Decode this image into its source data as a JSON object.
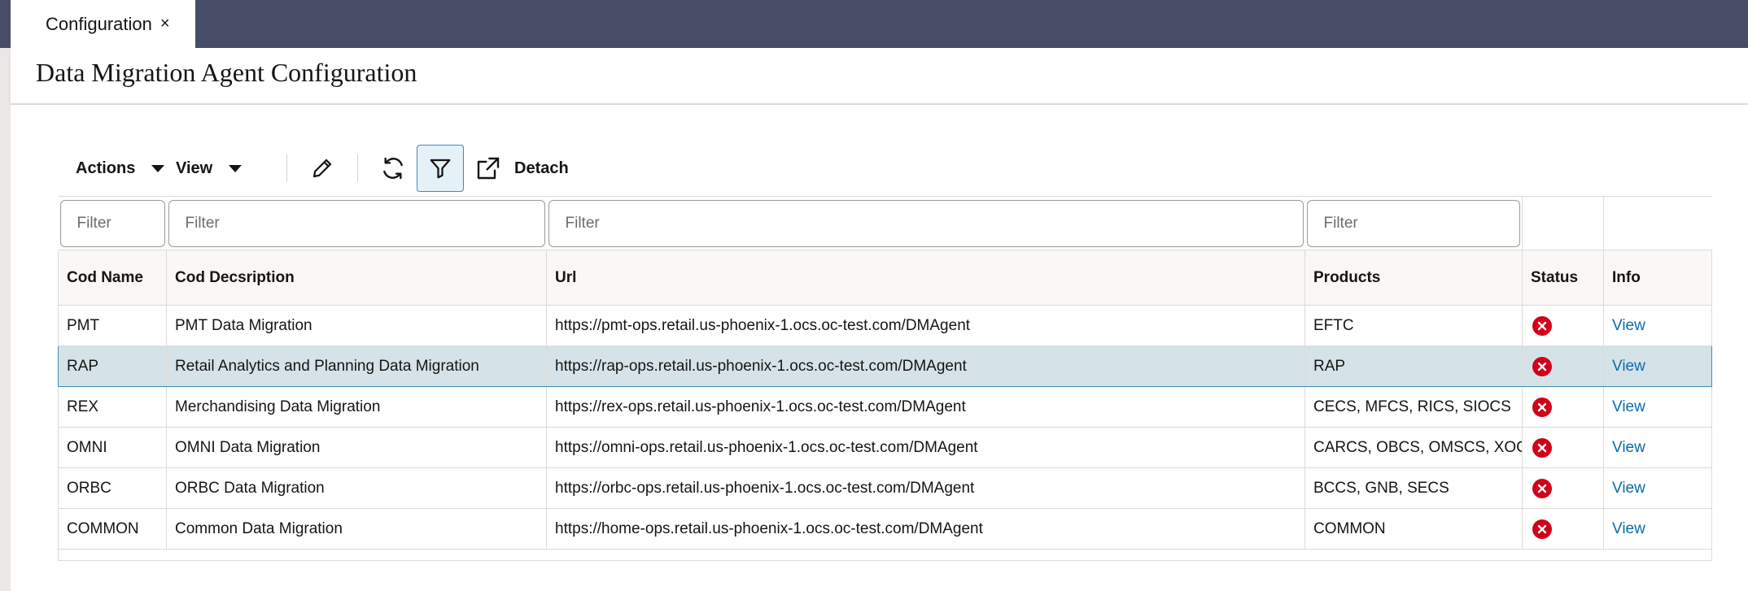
{
  "tab": {
    "label": "Configuration",
    "close": "×"
  },
  "page": {
    "title": "Data Migration Agent Configuration"
  },
  "toolbar": {
    "actions": "Actions",
    "view": "View",
    "detach": "Detach"
  },
  "filters": {
    "placeholder": "Filter"
  },
  "columns": [
    "Cod Name",
    "Cod Decsription",
    "Url",
    "Products",
    "Status",
    "Info"
  ],
  "rows": [
    {
      "code": "PMT",
      "description": "PMT Data Migration",
      "url": "https://pmt-ops.retail.us-phoenix-1.ocs.oc-test.com/DMAgent",
      "products": "EFTC",
      "status": "error",
      "info": "View"
    },
    {
      "code": "RAP",
      "description": "Retail Analytics and Planning Data Migration",
      "url": "https://rap-ops.retail.us-phoenix-1.ocs.oc-test.com/DMAgent",
      "products": "RAP",
      "status": "error",
      "info": "View"
    },
    {
      "code": "REX",
      "description": "Merchandising Data Migration",
      "url": "https://rex-ops.retail.us-phoenix-1.ocs.oc-test.com/DMAgent",
      "products": "CECS, MFCS, RICS, SIOCS",
      "status": "error",
      "info": "View"
    },
    {
      "code": "OMNI",
      "description": "OMNI Data Migration",
      "url": "https://omni-ops.retail.us-phoenix-1.ocs.oc-test.com/DMAgent",
      "products": "CARCS, OBCS, OMSCS, XOCS",
      "status": "error",
      "info": "View"
    },
    {
      "code": "ORBC",
      "description": "ORBC Data Migration",
      "url": "https://orbc-ops.retail.us-phoenix-1.ocs.oc-test.com/DMAgent",
      "products": "BCCS, GNB, SECS",
      "status": "error",
      "info": "View"
    },
    {
      "code": "COMMON",
      "description": "Common Data Migration",
      "url": "https://home-ops.retail.us-phoenix-1.ocs.oc-test.com/DMAgent",
      "products": "COMMON",
      "status": "error",
      "info": "View"
    }
  ],
  "colors": {
    "tabbar": "#474c67",
    "selected_row": "#d5e3e8",
    "link": "#0a6bab",
    "error": "#d0021b"
  }
}
